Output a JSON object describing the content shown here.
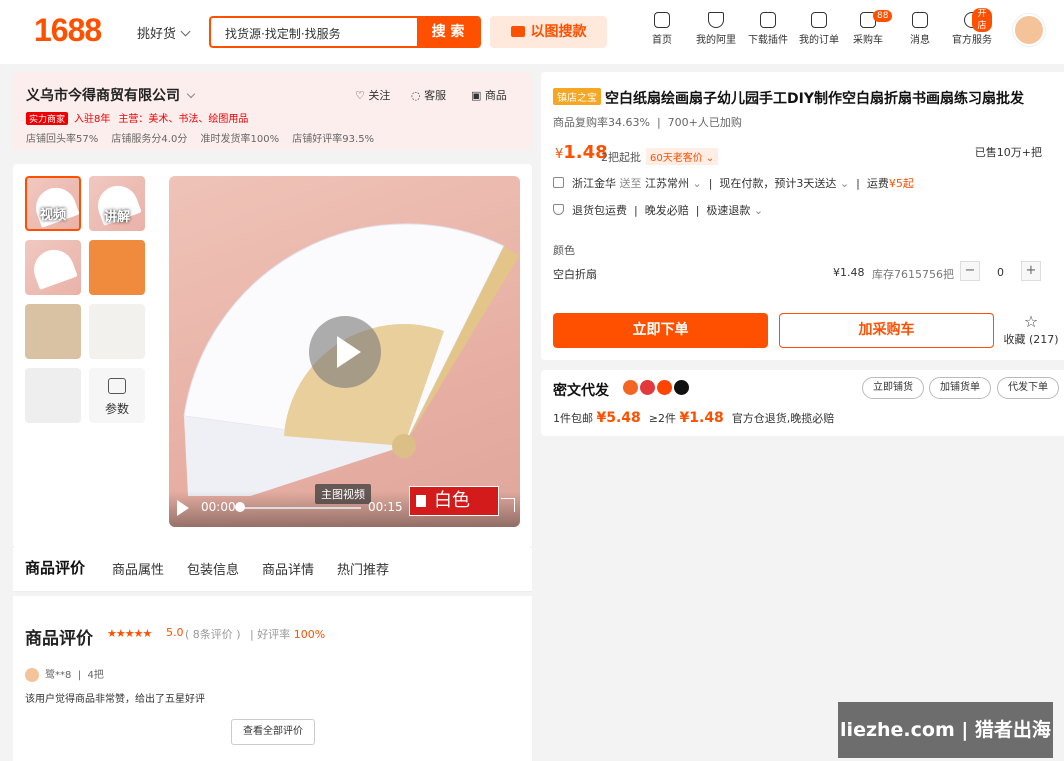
{
  "header": {
    "logo": "1688",
    "pick_goods": "挑好货",
    "search_placeholder": "找货源·找定制·找服务",
    "search_button": "搜 索",
    "image_search": "以图搜款",
    "nav": [
      {
        "label": "首页",
        "icon": "home-icon"
      },
      {
        "label": "我的阿里",
        "icon": "shield-icon"
      },
      {
        "label": "下载插件",
        "icon": "puzzle-icon"
      },
      {
        "label": "我的订单",
        "icon": "order-icon"
      },
      {
        "label": "采购车",
        "icon": "cart-icon",
        "badge": "88"
      },
      {
        "label": "消息",
        "icon": "message-icon"
      },
      {
        "label": "官方服务",
        "icon": "service-icon",
        "badge": "开店"
      }
    ]
  },
  "shop": {
    "name": "义乌市今得商贸有限公司",
    "follow": "关注",
    "service": "客服",
    "goods": "商品",
    "badge": "实力商家",
    "years": "入驻8年",
    "main": "主营：美术、书法、绘图用品",
    "stats": [
      "店铺回头率57%",
      "店铺服务分4.0分",
      "准时发货率100%",
      "店铺好评率93.5%"
    ]
  },
  "gallery": {
    "thumb_video": "视频",
    "thumb_explain": "讲解",
    "params": "参数",
    "video_tag": "主图视频",
    "time_start": "00:00",
    "time_end": "00:15",
    "overlay_text": "白色"
  },
  "tabs": [
    "商品评价",
    "商品属性",
    "包装信息",
    "商品详情",
    "热门推荐"
  ],
  "reviews": {
    "heading": "商品评价",
    "stars": "★★★★★",
    "score": "5.0",
    "count": "( 8条评价 )",
    "good_rate_label": "好评率",
    "good_rate": "100%",
    "user": "鹭**8",
    "qty": "4把",
    "text": "该用户觉得商品非常赞，给出了五星好评",
    "view_all": "查看全部评价"
  },
  "product": {
    "badge": "镇店之宝",
    "title": "空白纸扇绘画扇子幼儿园手工DIY制作空白扇折扇书画扇练习扇批发",
    "repurchase": "商品复购率34.63%",
    "added": "700+人已加购",
    "currency": "¥",
    "price": "1.48",
    "moq": "2把起批",
    "old_customer": "60天老客价",
    "sold": "已售10万+把",
    "ship_from": "浙江金华",
    "ship_to_label": "送至",
    "ship_to": "江苏常州",
    "delivery": "现在付款，预计3天送达",
    "freight_label": "运费",
    "freight": "¥5起",
    "guarantees": [
      "退货包运费",
      "晚发必赔",
      "极速退款"
    ],
    "color_label": "颜色",
    "option": "空白折扇",
    "option_price": "¥1.48",
    "stock": "库存7615756把",
    "minus": "−",
    "qty": "0",
    "plus": "+",
    "buy_now": "立即下单",
    "add_cart": "加采购车",
    "favorite": "收藏 (217)"
  },
  "distribution": {
    "heading": "密文代发",
    "btn_list": "立即铺货",
    "btn_add": "加铺货单",
    "btn_ship": "代发下单",
    "free_ship": "1件包邮",
    "price1": "¥5.48",
    "two_plus": "≥2件",
    "price2": "¥1.48",
    "note": "官方仓退货,晚揽必赔"
  },
  "watermark": "liezhe.com | 猎者出海"
}
